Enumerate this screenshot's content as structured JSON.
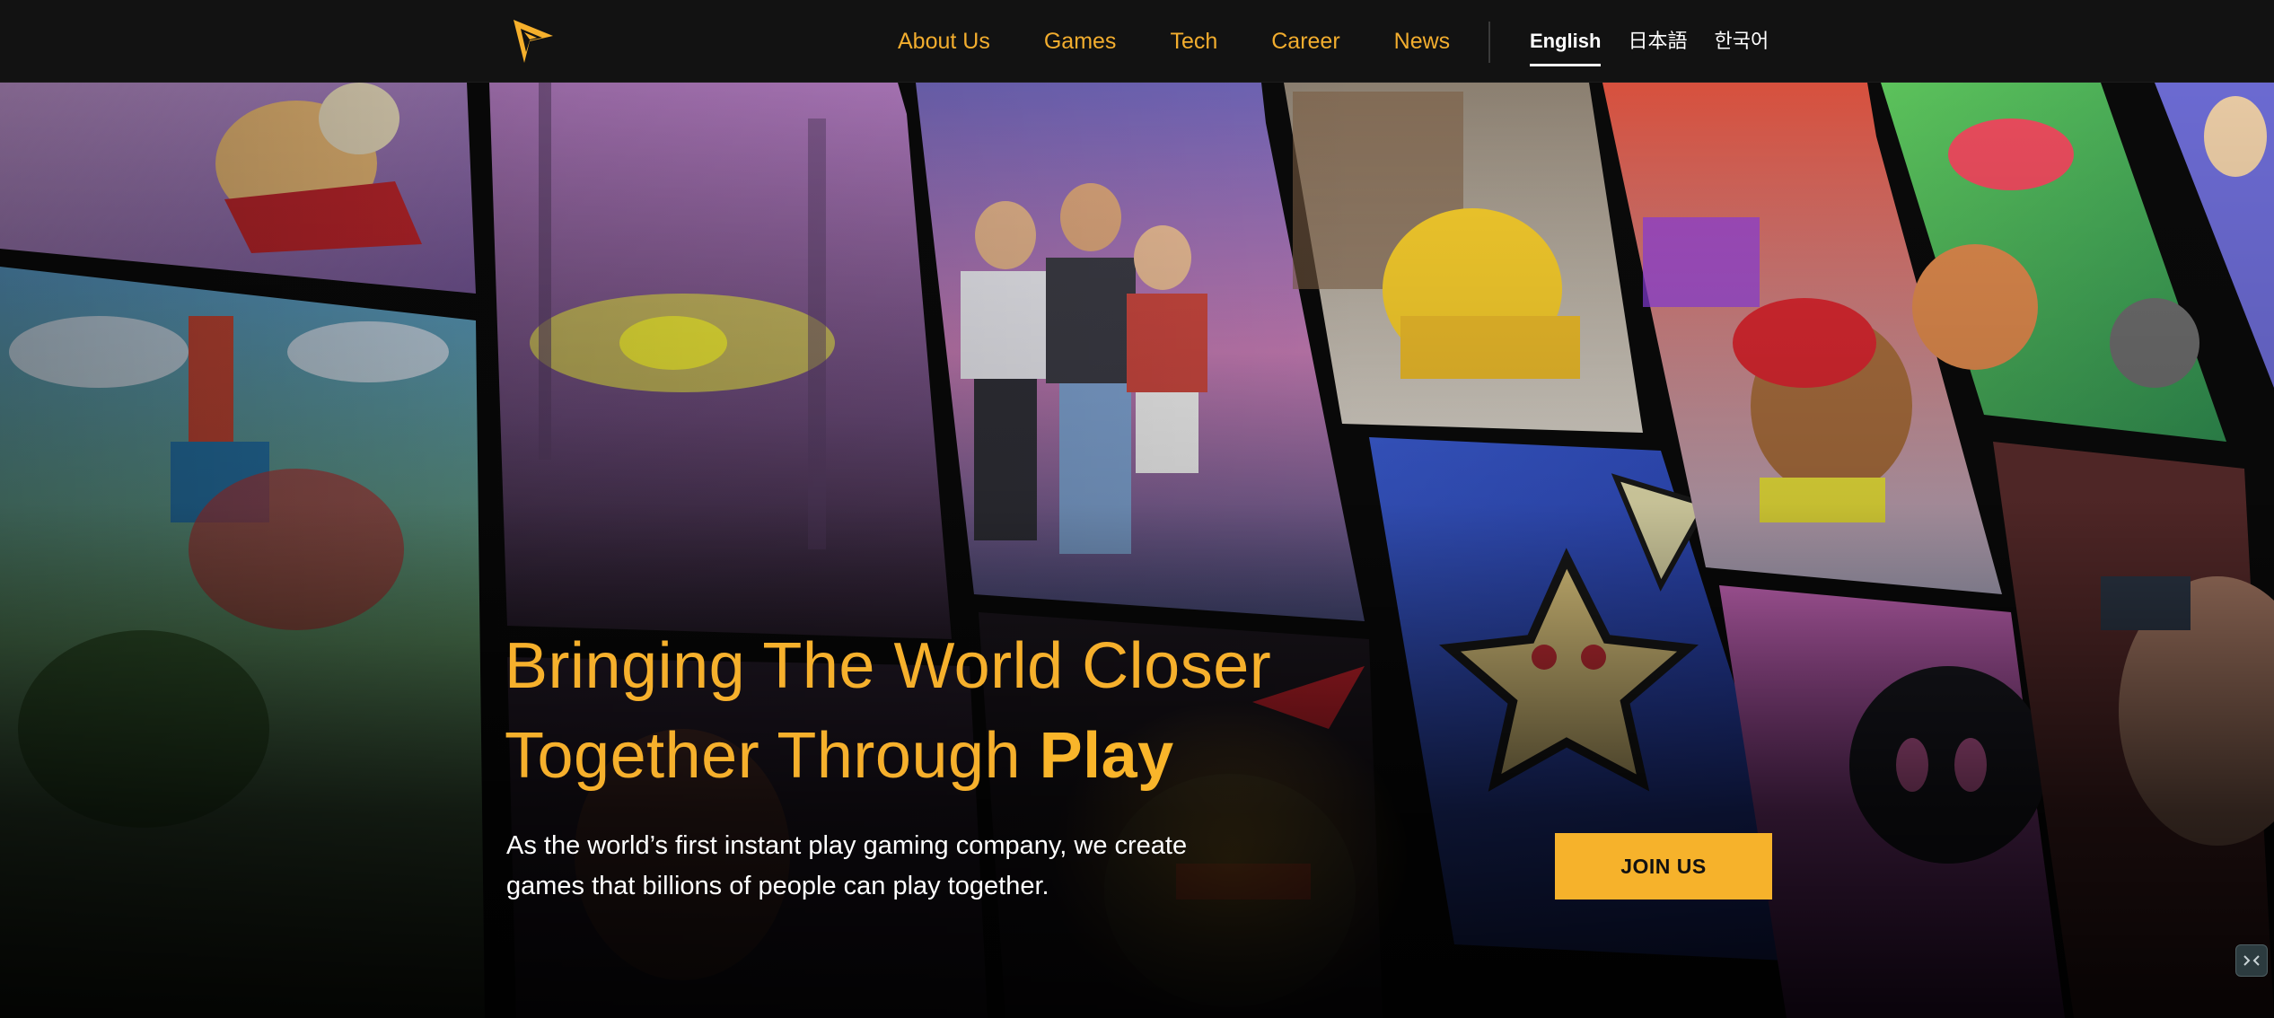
{
  "nav": {
    "logo_icon": "paper-plane-logo-icon",
    "links": [
      "About Us",
      "Games",
      "Tech",
      "Career",
      "News"
    ],
    "languages": [
      "English",
      "日本語",
      "한국어"
    ],
    "active_language": "English"
  },
  "hero": {
    "headline_line1": "Bringing The World Closer",
    "headline_line2_prefix": "Together Through ",
    "headline_line2_emphasis": "Play",
    "subtext_line1": "As the world’s first instant play gaming company, we create",
    "subtext_line2": "games that billions of people can play together.",
    "cta_label": "JOIN US",
    "corner_widget_icon": "collapse-arrows-icon"
  },
  "colors": {
    "accent": "#f6b02c",
    "nav_background": "#121212",
    "text_light": "#ffffff"
  }
}
